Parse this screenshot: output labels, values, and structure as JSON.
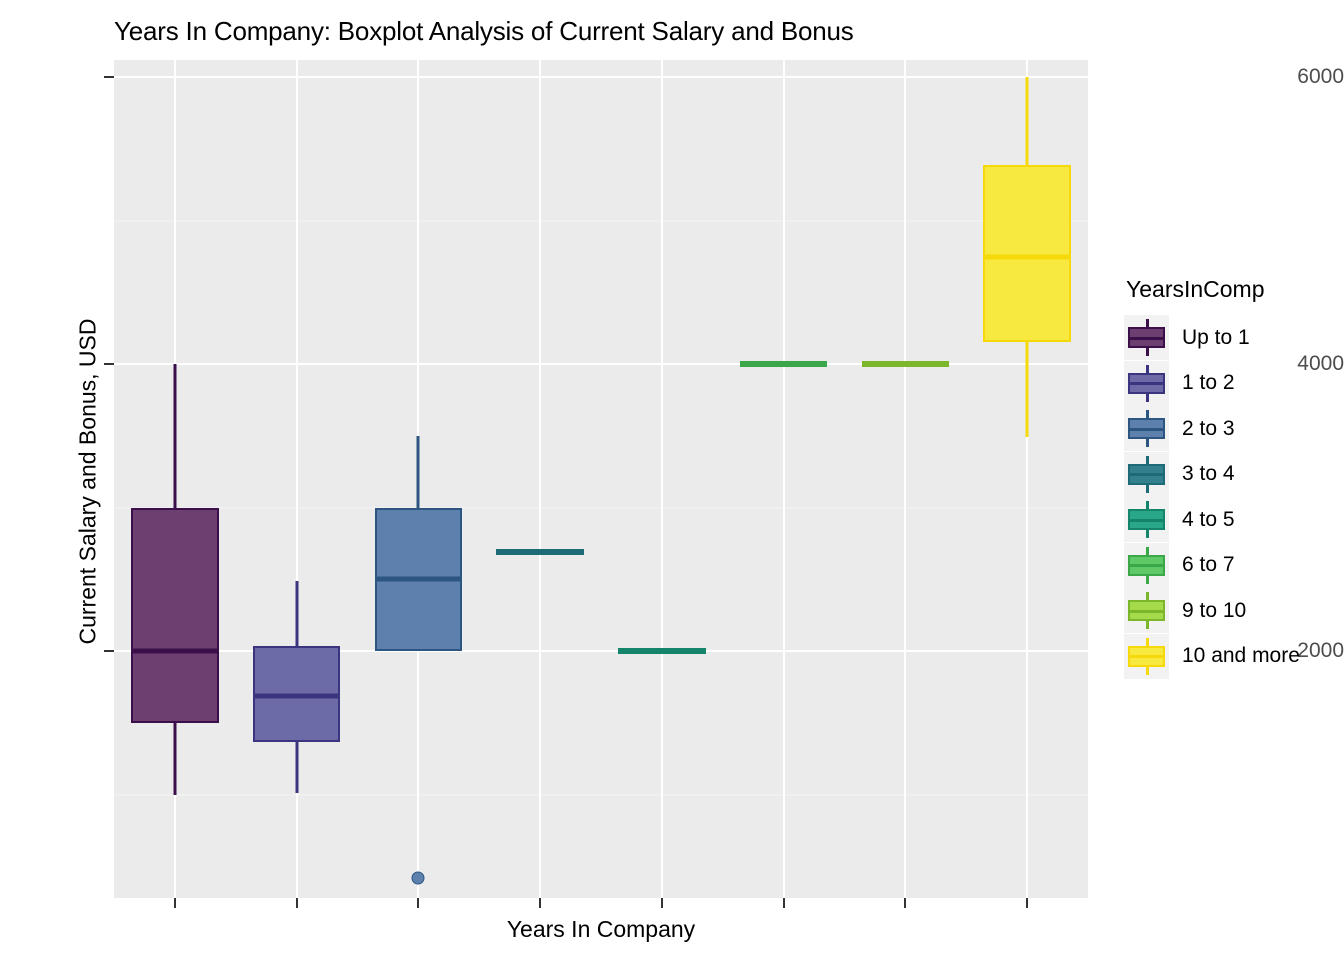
{
  "chart_data": {
    "type": "box",
    "title": "Years In Company: Boxplot Analysis of Current Salary and Bonus",
    "xlabel": "Years In Company",
    "ylabel": "Current Salary and Bonus, USD",
    "legend_title": "YearsInComp",
    "legend_position": "right",
    "grid": true,
    "ylim": [
      280,
      6120
    ],
    "yticks": [
      2000,
      4000,
      6000
    ],
    "ytick_labels": [
      "2000",
      "4000",
      "6000"
    ],
    "yminor_ticks": [
      1000,
      3000,
      5000
    ],
    "xtick_labels": [
      "",
      "",
      "",
      "",
      "",
      "",
      "",
      ""
    ],
    "categories": [
      "Up to 1",
      "1 to 2",
      "2 to 3",
      "3 to 4",
      "4 to 5",
      "6 to 7",
      "9 to 10",
      "10 and more"
    ],
    "colors": [
      "#6d3f71",
      "#6d6aa8",
      "#5d80ad",
      "#35808f",
      "#2aa787",
      "#5ec966",
      "#a5db4b",
      "#f7e93f"
    ],
    "edge_colors": [
      "#3b0f4a",
      "#3b3580",
      "#2c5582",
      "#1e6b78",
      "#14856a",
      "#3aa849",
      "#7cb62b",
      "#f5d90b"
    ],
    "boxes": [
      {
        "category": "Up to 1",
        "whisker_low": 1000,
        "q1": 1500,
        "median": 2000,
        "q3": 3000,
        "whisker_high": 4000,
        "outliers": []
      },
      {
        "category": "1 to 2",
        "whisker_low": 1010,
        "q1": 1370,
        "median": 1690,
        "q3": 2035,
        "whisker_high": 2490,
        "outliers": []
      },
      {
        "category": "2 to 3",
        "whisker_low": 2000,
        "q1": 2000,
        "median": 2500,
        "q3": 3000,
        "whisker_high": 3500,
        "outliers": [
          420
        ]
      },
      {
        "category": "3 to 4",
        "whisker_low": 2690,
        "q1": 2690,
        "median": 2690,
        "q3": 2690,
        "whisker_high": 2690,
        "outliers": []
      },
      {
        "category": "4 to 5",
        "whisker_low": 2000,
        "q1": 2000,
        "median": 2000,
        "q3": 2000,
        "whisker_high": 2000,
        "outliers": []
      },
      {
        "category": "6 to 7",
        "whisker_low": 4000,
        "q1": 4000,
        "median": 4000,
        "q3": 4000,
        "whisker_high": 4000,
        "outliers": []
      },
      {
        "category": "9 to 10",
        "whisker_low": 4000,
        "q1": 4000,
        "median": 4000,
        "q3": 4000,
        "whisker_high": 4000,
        "outliers": []
      },
      {
        "category": "10 and more",
        "whisker_low": 3490,
        "q1": 4155,
        "median": 4745,
        "q3": 5390,
        "whisker_high": 6000,
        "outliers": []
      }
    ]
  },
  "legend": {
    "title": "YearsInComp",
    "items": [
      {
        "label": "Up to 1"
      },
      {
        "label": "1 to 2"
      },
      {
        "label": "2 to 3"
      },
      {
        "label": "3 to 4"
      },
      {
        "label": "4 to 5"
      },
      {
        "label": "6 to 7"
      },
      {
        "label": "9 to 10"
      },
      {
        "label": "10 and more"
      }
    ]
  }
}
